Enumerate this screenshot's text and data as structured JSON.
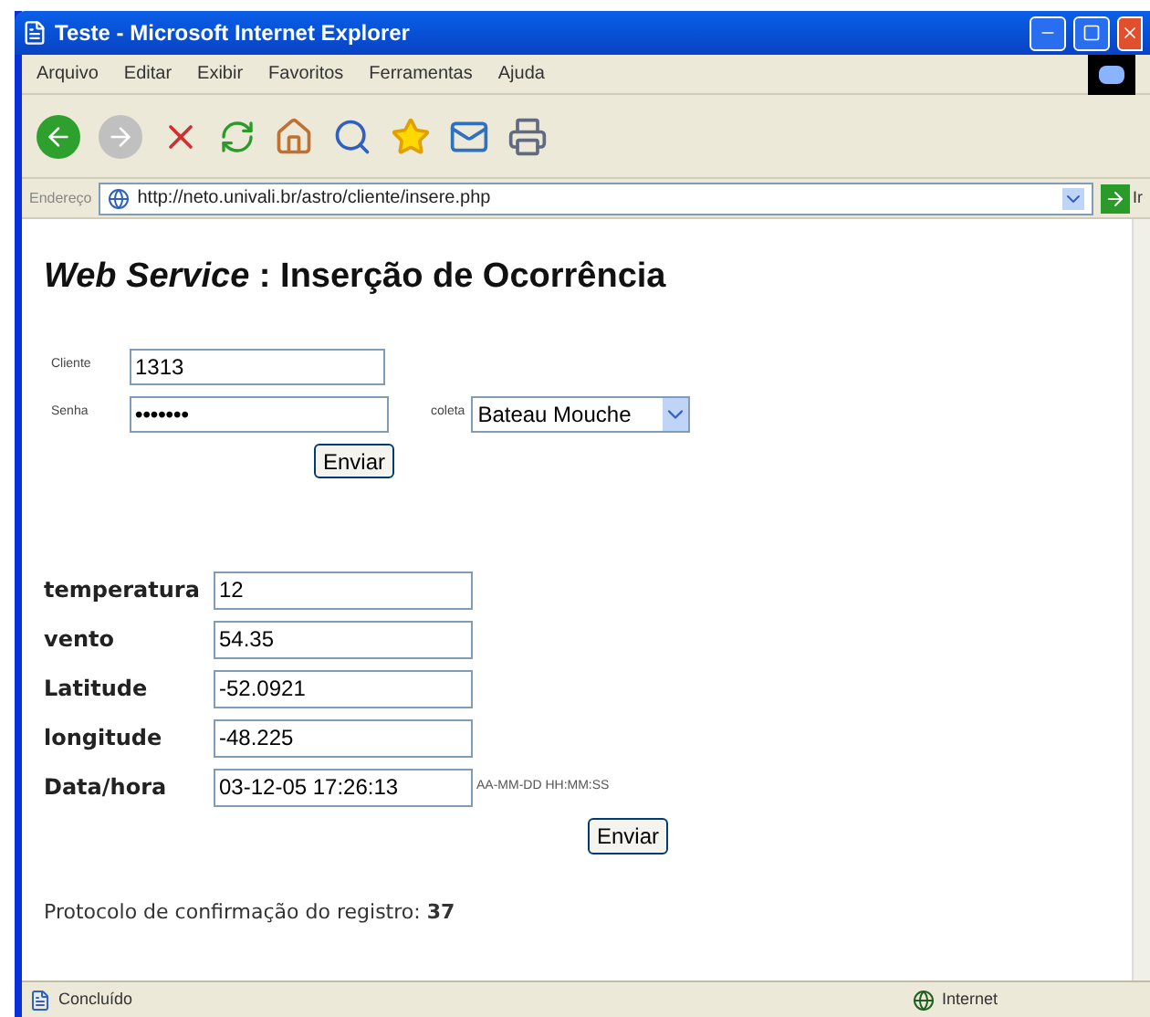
{
  "window": {
    "title": "Teste - Microsoft Internet Explorer"
  },
  "menu": [
    "Arquivo",
    "Editar",
    "Exibir",
    "Favoritos",
    "Ferramentas",
    "Ajuda"
  ],
  "address_bar": {
    "label": "Endereço",
    "url": "http://neto.univali.br/astro/cliente/insere.php",
    "go": "Ir"
  },
  "heading": "*Web Service* : Inserção de Ocorrência",
  "login": {
    "cliente": {
      "label": "Cliente",
      "value": "1313"
    },
    "senha": {
      "label": "Senha",
      "value": "•••••••"
    },
    "coleta": {
      "label": "coleta",
      "value": "Bateau Mouche"
    },
    "button": "Enviar"
  },
  "fields": [
    {
      "label": "temperatura",
      "value": "12"
    },
    {
      "label": "vento",
      "value": "54.35"
    },
    {
      "label": "Latitude",
      "value": "-52.0921"
    },
    {
      "label": "longitude",
      "value": "-48.225"
    },
    {
      "label": "Data/hora",
      "value": "03-12-05 17:26:13",
      "hint": "AA-MM-DD HH:MM:SS"
    }
  ],
  "submit": "Enviar",
  "protocol": "Protocolo de confirmação do registro: **37**",
  "status_bar": {
    "text": "Concluído",
    "zone": "Internet"
  }
}
